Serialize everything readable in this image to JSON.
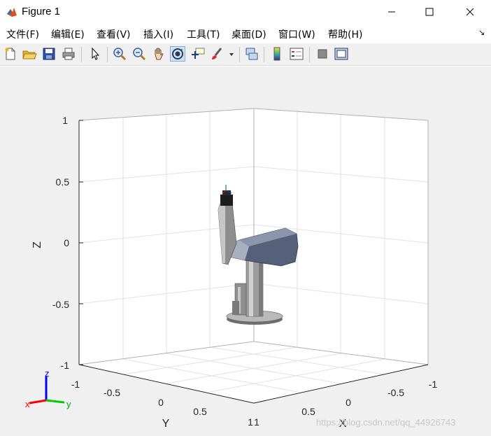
{
  "window": {
    "title": "Figure 1"
  },
  "menu": {
    "items": [
      {
        "label": "文件(F)"
      },
      {
        "label": "编辑(E)"
      },
      {
        "label": "查看(V)"
      },
      {
        "label": "插入(I)"
      },
      {
        "label": "工具(T)"
      },
      {
        "label": "桌面(D)"
      },
      {
        "label": "窗口(W)"
      },
      {
        "label": "帮助(H)"
      }
    ],
    "dock_arrow": "↘"
  },
  "toolbar": {
    "icons": [
      "new-figure-icon",
      "open-file-icon",
      "save-icon",
      "print-icon",
      "pointer-icon",
      "zoom-in-icon",
      "zoom-out-icon",
      "pan-icon",
      "rotate-3d-icon",
      "data-cursor-icon",
      "brush-icon",
      "brush-dropdown-icon",
      "link-plot-icon",
      "insert-colorbar-icon",
      "insert-legend-icon",
      "hide-plot-tools-icon",
      "show-plot-tools-icon"
    ],
    "active": "rotate-3d-icon"
  },
  "axes": {
    "z_ticks": [
      "1",
      "0.5",
      "0",
      "-0.5",
      "-1"
    ],
    "y_ticks": [
      "-1",
      "-0.5",
      "0",
      "0.5",
      "1"
    ],
    "x_ticks": [
      "-1",
      "-0.5",
      "0",
      "0.5",
      "1"
    ],
    "x_label": "X",
    "y_label": "Y",
    "z_label": "Z",
    "background": "#ffffff",
    "grid_color": "#e2e2e2"
  },
  "triad": {
    "x": "x",
    "y": "y",
    "z": "z",
    "x_color": "#ff0000",
    "y_color": "#00cc00",
    "z_color": "#0000ff"
  },
  "watermark": "https://blog.csdn.net/qq_44926743"
}
